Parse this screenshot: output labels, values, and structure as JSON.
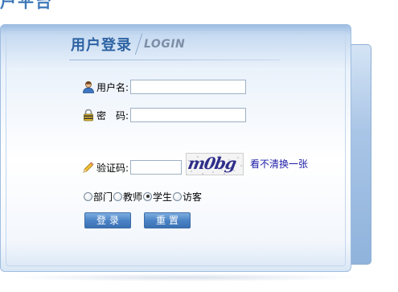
{
  "header": {
    "cut_text": "户平台"
  },
  "login": {
    "title_cn": "用户登录",
    "title_en": "LOGIN",
    "username_label": "用户名:",
    "username_value": "",
    "password_label": "密　码:",
    "password_value": "",
    "captcha_label": "验证码:",
    "captcha_value": "",
    "captcha_image_text": "m0bg",
    "refresh_link": "看不清换一张",
    "roles": [
      {
        "label": "部门",
        "checked": false
      },
      {
        "label": "教师",
        "checked": false
      },
      {
        "label": "学生",
        "checked": true
      },
      {
        "label": "访客",
        "checked": false
      }
    ],
    "submit_label": "登录",
    "reset_label": "重置"
  },
  "colors": {
    "title_blue": "#2e63a3",
    "button_blue": "#4b84c6",
    "link_blue": "#1c1ca8"
  }
}
